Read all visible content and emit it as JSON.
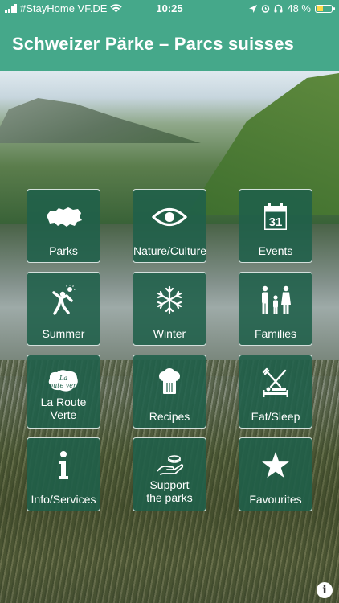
{
  "status_bar": {
    "carrier": "#StayHome VF.DE",
    "time": "10:25",
    "battery": "48 %",
    "battery_level": 0.48
  },
  "header": {
    "title": "Schweizer Pärke – Parcs suisses"
  },
  "tiles": [
    {
      "label": "Parks",
      "icon": "switzerland-map-icon"
    },
    {
      "label": "Nature/Culture",
      "icon": "eye-icon"
    },
    {
      "label": "Events",
      "icon": "calendar-icon",
      "icon_text": "31"
    },
    {
      "label": "Summer",
      "icon": "summer-person-sun-icon"
    },
    {
      "label": "Winter",
      "icon": "snowflake-icon"
    },
    {
      "label": "Families",
      "icon": "family-icon"
    },
    {
      "label_line1": "La Route",
      "label_line2": "Verte",
      "icon": "la-route-verte-logo",
      "icon_text": "La Route verte"
    },
    {
      "label": "Recipes",
      "icon": "chef-hat-icon"
    },
    {
      "label": "Eat/Sleep",
      "icon": "fork-knife-bed-icon"
    },
    {
      "label": "Info/Services",
      "icon": "info-icon"
    },
    {
      "label_line1": "Support",
      "label_line2": "the parks",
      "icon": "hand-coin-icon"
    },
    {
      "label": "Favourites",
      "icon": "star-icon"
    }
  ],
  "footer": {
    "info_icon": "info-circle-icon"
  }
}
